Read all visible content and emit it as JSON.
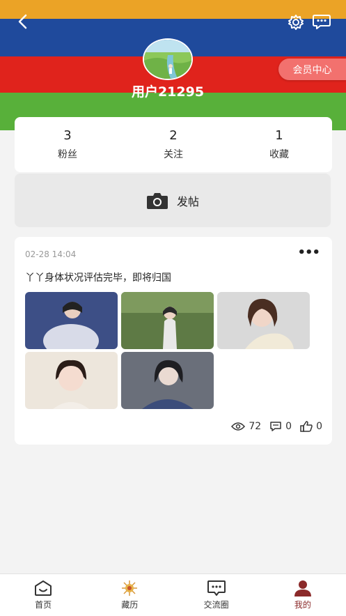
{
  "profile": {
    "username": "用户21295",
    "vip_label": "会员中心"
  },
  "stats": [
    {
      "value": "3",
      "label": "粉丝"
    },
    {
      "value": "2",
      "label": "关注"
    },
    {
      "value": "1",
      "label": "收藏"
    }
  ],
  "post_button": {
    "label": "发帖"
  },
  "post": {
    "date": "02-28 14:04",
    "text": "丫丫身体状况评估完毕，即将归国",
    "more": "•••",
    "views": "72",
    "comments": "0",
    "likes": "0"
  },
  "tabs": [
    {
      "label": "首页",
      "active": false
    },
    {
      "label": "藏历",
      "active": false
    },
    {
      "label": "交流圈",
      "active": false
    },
    {
      "label": "我的",
      "active": true
    }
  ],
  "colors": {
    "stripe_orange": "#eba326",
    "stripe_blue": "#1f4a9c",
    "stripe_red": "#e0231c",
    "stripe_green": "#58b03a",
    "vip_button": "#f2716e",
    "active_tab": "#8b2a2a"
  }
}
